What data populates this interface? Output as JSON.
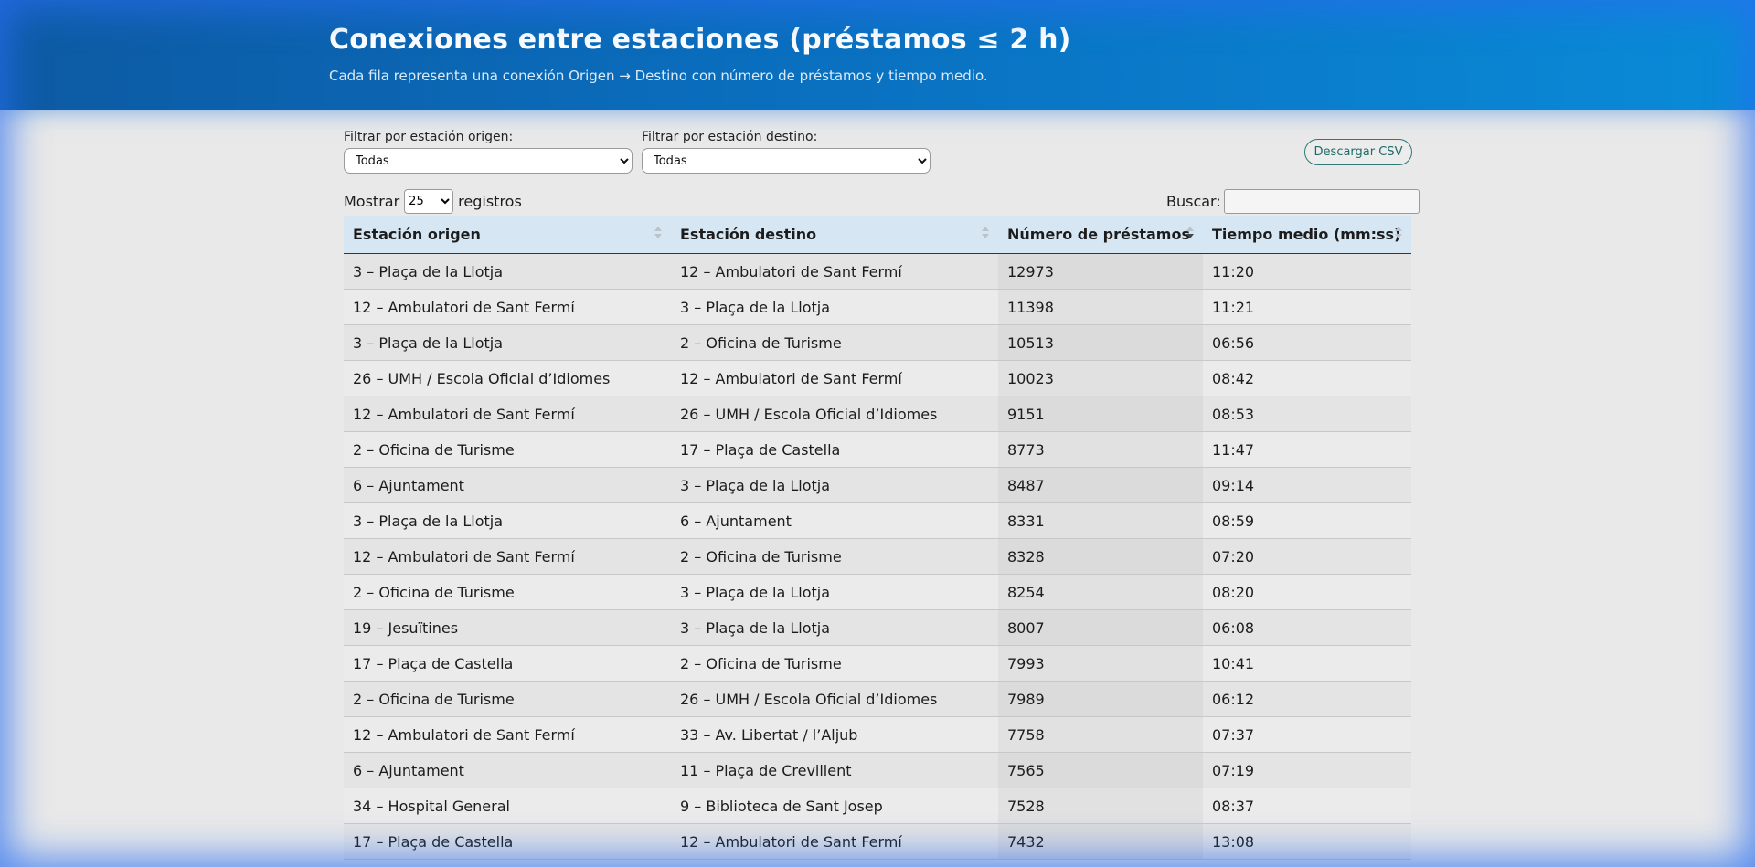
{
  "header": {
    "title": "Conexiones entre estaciones (préstamos ≤ 2 h)",
    "subtitle": "Cada fila representa una conexión Origen → Destino con número de préstamos y tiempo medio."
  },
  "filters": {
    "origin_label": "Filtrar por estación origen:",
    "origin_value": "Todas",
    "destination_label": "Filtrar por estación destino:",
    "destination_value": "Todas"
  },
  "toolbar": {
    "csv_label": "Descargar CSV"
  },
  "table_controls": {
    "show_label": "Mostrar",
    "page_length": "25",
    "records_label": "registros",
    "search_label": "Buscar:",
    "search_value": ""
  },
  "table": {
    "sorted_column": 2,
    "sort_direction": "descending",
    "columns": [
      "Estación origen",
      "Estación destino",
      "Número de préstamos",
      "Tiempo medio (mm:ss)"
    ],
    "rows": [
      [
        "3 – Plaça de la Llotja",
        "12 – Ambulatori de Sant Fermí",
        "12973",
        "11:20"
      ],
      [
        "12 – Ambulatori de Sant Fermí",
        "3 – Plaça de la Llotja",
        "11398",
        "11:21"
      ],
      [
        "3 – Plaça de la Llotja",
        "2 – Oficina de Turisme",
        "10513",
        "06:56"
      ],
      [
        "26 – UMH / Escola Oficial d’Idiomes",
        "12 – Ambulatori de Sant Fermí",
        "10023",
        "08:42"
      ],
      [
        "12 – Ambulatori de Sant Fermí",
        "26 – UMH / Escola Oficial d’Idiomes",
        "9151",
        "08:53"
      ],
      [
        "2 – Oficina de Turisme",
        "17 – Plaça de Castella",
        "8773",
        "11:47"
      ],
      [
        "6 – Ajuntament",
        "3 – Plaça de la Llotja",
        "8487",
        "09:14"
      ],
      [
        "3 – Plaça de la Llotja",
        "6 – Ajuntament",
        "8331",
        "08:59"
      ],
      [
        "12 – Ambulatori de Sant Fermí",
        "2 – Oficina de Turisme",
        "8328",
        "07:20"
      ],
      [
        "2 – Oficina de Turisme",
        "3 – Plaça de la Llotja",
        "8254",
        "08:20"
      ],
      [
        "19 – Jesuïtines",
        "3 – Plaça de la Llotja",
        "8007",
        "06:08"
      ],
      [
        "17 – Plaça de Castella",
        "2 – Oficina de Turisme",
        "7993",
        "10:41"
      ],
      [
        "2 – Oficina de Turisme",
        "26 – UMH / Escola Oficial d’Idiomes",
        "7989",
        "06:12"
      ],
      [
        "12 – Ambulatori de Sant Fermí",
        "33 – Av. Libertat / l’Aljub",
        "7758",
        "07:37"
      ],
      [
        "6 – Ajuntament",
        "11 – Plaça de Crevillent",
        "7565",
        "07:19"
      ],
      [
        "34 – Hospital General",
        "9 – Biblioteca de Sant Josep",
        "7528",
        "08:37"
      ],
      [
        "17 – Plaça de Castella",
        "12 – Ambulatori de Sant Fermí",
        "7432",
        "13:08"
      ]
    ]
  }
}
